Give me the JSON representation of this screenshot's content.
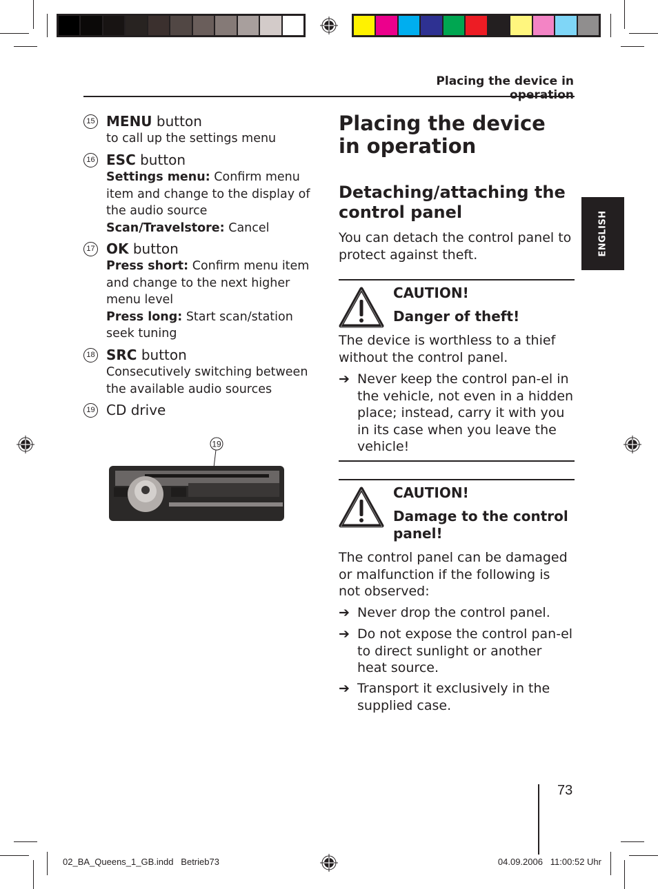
{
  "print_marks": {
    "gray_swatches": [
      "#000000",
      "#0b0908",
      "#181413",
      "#282321",
      "#3b302e",
      "#514744",
      "#6a5e5b",
      "#857a77",
      "#a89f9d",
      "#d3cbc9",
      "#ffffff"
    ],
    "color_swatches": [
      "#fff200",
      "#ec008c",
      "#00aeef",
      "#2e3192",
      "#00a651",
      "#ed1c24",
      "#231f20",
      "#fff67e",
      "#f384c5",
      "#7fd6f7",
      "#908e8e"
    ]
  },
  "header": {
    "running_head": "Placing the device in operation"
  },
  "side_tab": {
    "label": "ENGLISH"
  },
  "controls": [
    {
      "number": "15",
      "name": "MENU",
      "suffix": " button",
      "desc": [
        {
          "bold": "",
          "text": "to call up the settings menu"
        }
      ]
    },
    {
      "number": "16",
      "name": "ESC",
      "suffix": " button",
      "desc": [
        {
          "bold": "Settings menu:",
          "text": " Confirm menu item and change to the display of the audio source"
        },
        {
          "bold": "Scan/Travelstore:",
          "text": " Cancel"
        }
      ]
    },
    {
      "number": "17",
      "name": "OK",
      "suffix": " button",
      "desc": [
        {
          "bold": "Press short:",
          "text": " Confirm menu item and change to the next higher menu level"
        },
        {
          "bold": "Press long:",
          "text": " Start scan/station seek tuning"
        }
      ]
    },
    {
      "number": "18",
      "name": "SRC",
      "suffix": " button",
      "desc": [
        {
          "bold": "",
          "text": "Consecutively switching between the available audio sources"
        }
      ]
    },
    {
      "number": "19",
      "name": "",
      "suffix": "CD drive",
      "desc": []
    }
  ],
  "figure": {
    "callout": "19"
  },
  "main": {
    "title": "Placing the device in operation",
    "section_title": "Detaching/attaching the control panel",
    "intro": "You can detach the control panel to protect against theft.",
    "cautions": [
      {
        "label": "CAUTION!",
        "subtitle": "Danger of theft!",
        "body": "The device is worthless to a thief without the control panel.",
        "bullets": [
          "Never keep the control pan-el in the vehicle, not even in a hidden place; instead, carry it with you in its case when you leave the vehicle!"
        ]
      },
      {
        "label": "CAUTION!",
        "subtitle": "Damage to the control panel!",
        "body": "The control panel can be damaged or malfunction if the following is not observed:",
        "bullets": [
          "Never drop the control panel.",
          "Do not expose the control pan-el to direct sunlight or another heat source.",
          "Transport it exclusively in the supplied case."
        ]
      }
    ],
    "bullet_symbol": "➔"
  },
  "footer": {
    "page_number": "73",
    "slug_left": "02_BA_Queens_1_GB.indd   Betrieb73",
    "slug_right": "04.09.2006   11:00:52 Uhr"
  }
}
